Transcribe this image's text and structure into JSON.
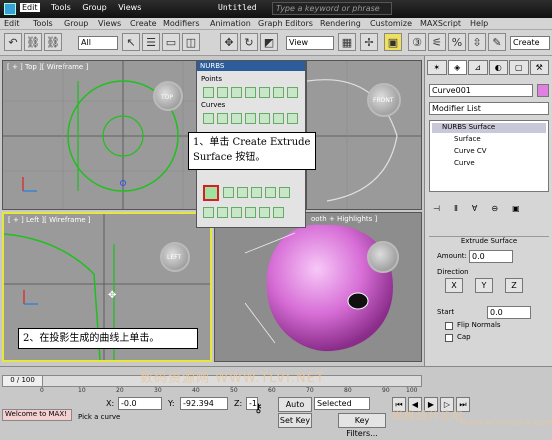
{
  "app": {
    "title": "Untitled",
    "search_placeholder": "Type a keyword or phrase",
    "menu": [
      "Edit",
      "Tools",
      "Group",
      "Views",
      "Create",
      "Modifiers",
      "Animation",
      "Graph Editors",
      "Rendering",
      "Customize",
      "MAXScript",
      "Help"
    ],
    "active_menu": "Edit"
  },
  "toolbar": {
    "selection_filter": "All",
    "ref_coord": "View",
    "create_label": "Create"
  },
  "viewports": {
    "top": "[ + ] Top ][ Wireframe ]",
    "front_gizmo": "FRONT",
    "top_gizmo": "TOP",
    "left": "[ + ] Left ][ Wireframe ]",
    "persp": "ooth + Highlights ]",
    "left_gizmo": "LEFT"
  },
  "nurbs": {
    "title": "NURBS",
    "points": "Points",
    "curves": "Curves"
  },
  "callouts": {
    "step1": "1、单击 Create Extrude",
    "step1b": "Surface 按钮。",
    "step2": "2、在投影生成的曲线上单击。"
  },
  "command_panel": {
    "object_name": "Curve001",
    "modifier_list": "Modifier List",
    "stack": [
      "NURBS Surface",
      "Surface",
      "Curve CV",
      "Curve"
    ],
    "rollout_title": "Extrude Surface",
    "amount_label": "Amount:",
    "amount_value": "0.0",
    "direction_label": "Direction",
    "axes": [
      "X",
      "Y",
      "Z"
    ],
    "start_label": "Start",
    "start_value": "0.0",
    "flip_normals": "Flip Normals",
    "cap": "Cap"
  },
  "timeline": {
    "frame": "0 / 100",
    "ticks": [
      "0",
      "10",
      "20",
      "30",
      "40",
      "50",
      "60",
      "70",
      "80",
      "90",
      "100"
    ]
  },
  "status": {
    "welcome": "Welcome to MAX!",
    "prompt": "Pick a curve",
    "x_label": "X:",
    "x_value": "-0.0",
    "y_label": "Y:",
    "y_value": "-92.394",
    "z_label": "Z:",
    "z_value": "-1",
    "auto_key": "Auto Key",
    "set_key": "Set Key",
    "key_mode": "Selected",
    "key_filters": "Key Filters..."
  },
  "watermark": {
    "left": "数码资源网 WWW.TLVI.NET",
    "right": "思缘设计论坛",
    "url": "WWW.MISSYUAN.COM"
  },
  "colors": {
    "nurbs_curve": "#1ec01e",
    "apple": "#d76ed7",
    "active_viewport_border": "#e6e63c",
    "highlight_button": "#d42020"
  }
}
